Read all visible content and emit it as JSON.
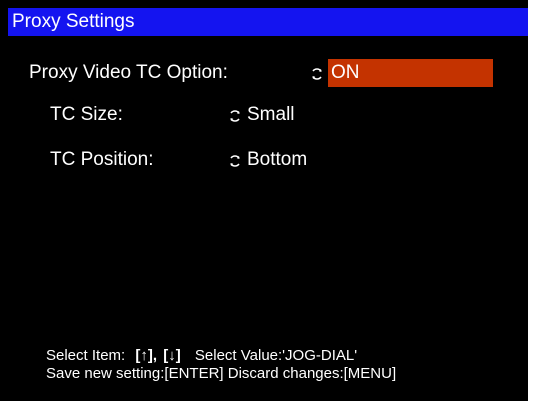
{
  "window": {
    "title": "Proxy Settings"
  },
  "items": [
    {
      "label": "Proxy Video TC Option:",
      "value": "ON",
      "selected": true
    },
    {
      "label": "TC Size:",
      "value": "Small",
      "selected": false
    },
    {
      "label": "TC Position:",
      "value": "Bottom",
      "selected": false
    }
  ],
  "footer": {
    "select_item_label": "Select Item:",
    "key_up": "[↑]",
    "key_sep": ",",
    "key_down": "[↓]",
    "select_value_label": "Select Value:'JOG-DIAL'",
    "save_label": "Save new setting:[ENTER]",
    "discard_label": "Discard changes:[MENU]"
  },
  "colors": {
    "title_bar": "#1414f0",
    "selection": "#c43300",
    "background": "#000000",
    "text": "#ffffff"
  },
  "icons": {
    "value_cycle": "cycle-arrows-icon"
  }
}
